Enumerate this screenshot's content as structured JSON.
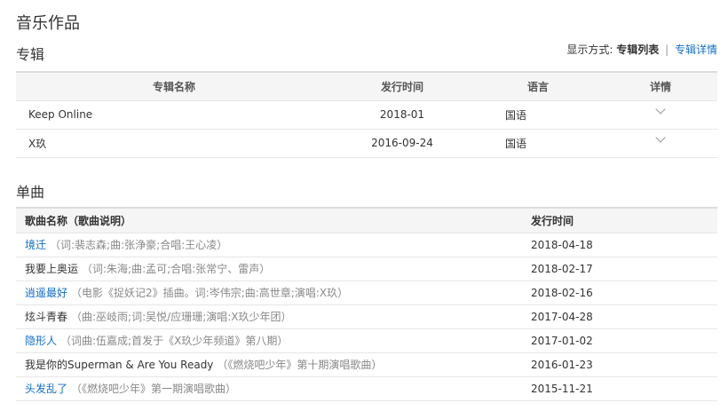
{
  "page_title": "音乐作品",
  "albums": {
    "heading": "专辑",
    "display_mode": {
      "label": "显示方式:",
      "current": "专辑列表",
      "separator": "|",
      "alt": "专辑详情"
    },
    "columns": [
      "专辑名称",
      "发行时间",
      "语言",
      "详情"
    ],
    "rows": [
      {
        "name": "Keep Online",
        "date": "2018-01",
        "lang": "国语"
      },
      {
        "name": "X玖",
        "date": "2016-09-24",
        "lang": "国语"
      }
    ]
  },
  "singles": {
    "heading": "单曲",
    "columns": [
      "歌曲名称（歌曲说明）",
      "发行时间"
    ],
    "rows": [
      {
        "title": "境迁",
        "linked": true,
        "note": "（词:裴志森;曲:张浄豪;合唱:王心凌）",
        "date": "2018-04-18"
      },
      {
        "title": "我要上奥运",
        "linked": false,
        "note": "（词:朱海;曲:孟可;合唱:张常宁、雷声）",
        "date": "2018-02-17"
      },
      {
        "title": "逍遥最好",
        "linked": true,
        "note": "（电影《捉妖记2》插曲。词:岑伟宗;曲:高世章;演唱:X玖）",
        "date": "2018-02-16"
      },
      {
        "title": "炫斗青春",
        "linked": false,
        "note": "（曲:巫岐雨;词:吴悦/应珊珊;演唱:X玖少年团）",
        "date": "2017-04-28"
      },
      {
        "title": "隐形人",
        "linked": true,
        "note": "（词曲:伍嘉成;首发于《X玖少年频道》第八期）",
        "date": "2017-01-02"
      },
      {
        "title": "我是你的Superman & Are You Ready",
        "linked": false,
        "note": "（《燃烧吧少年》第十期演唱歌曲）",
        "date": "2016-01-23"
      },
      {
        "title": "头发乱了",
        "linked": true,
        "note": "（《燃烧吧少年》第一期演唱歌曲）",
        "date": "2015-11-21"
      }
    ]
  }
}
